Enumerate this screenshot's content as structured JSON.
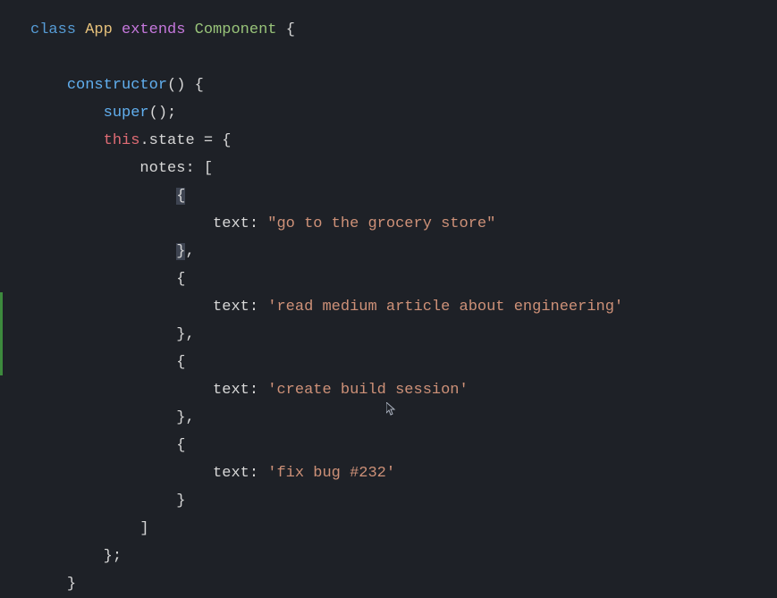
{
  "code": {
    "kw_class": "class",
    "class_name": "App",
    "kw_extends": "extends",
    "component": "Component",
    "brace_open": "{",
    "brace_close": "}",
    "bracket_open": "[",
    "bracket_close": "]",
    "paren_open": "(",
    "paren_close": ")",
    "semicolon": ";",
    "comma": ",",
    "equals": "=",
    "colon": ":",
    "constructor": "constructor",
    "super": "super",
    "this": "this",
    "dot": ".",
    "state": "state",
    "notes": "notes",
    "text_key": "text",
    "note1": "\"go to the grocery store\"",
    "note2": "'read medium article about engineering'",
    "note3": "'create build session'",
    "note4": "'fix bug #232'"
  },
  "colors": {
    "bg": "#1e2127",
    "default": "#abb2bf",
    "keyword": "#c678dd",
    "classKw": "#569cd6",
    "className": "#e5c07b",
    "component": "#98c379",
    "method": "#61afef",
    "this": "#e06c75",
    "string": "#ce9178",
    "string2": "#d19a66",
    "gutterMod": "#3d8a3d"
  }
}
